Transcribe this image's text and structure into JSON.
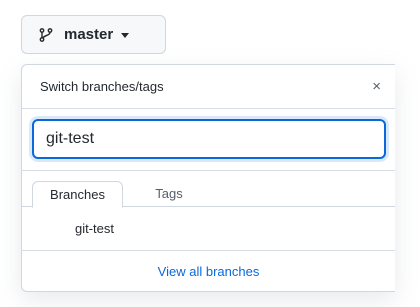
{
  "branch_button": {
    "current_branch": "master",
    "icon": "git-branch-icon"
  },
  "dropdown": {
    "title": "Switch branches/tags",
    "close_glyph": "×",
    "filter": {
      "value": "git-test",
      "placeholder": ""
    },
    "tabs": [
      {
        "label": "Branches",
        "active": true
      },
      {
        "label": "Tags",
        "active": false
      }
    ],
    "branches": [
      {
        "name": "git-test"
      }
    ],
    "view_all_label": "View all branches"
  },
  "colors": {
    "accent": "#0969da",
    "border": "#d0d7de",
    "button_bg": "#f6f8fa",
    "text": "#24292f",
    "muted": "#57606a"
  }
}
